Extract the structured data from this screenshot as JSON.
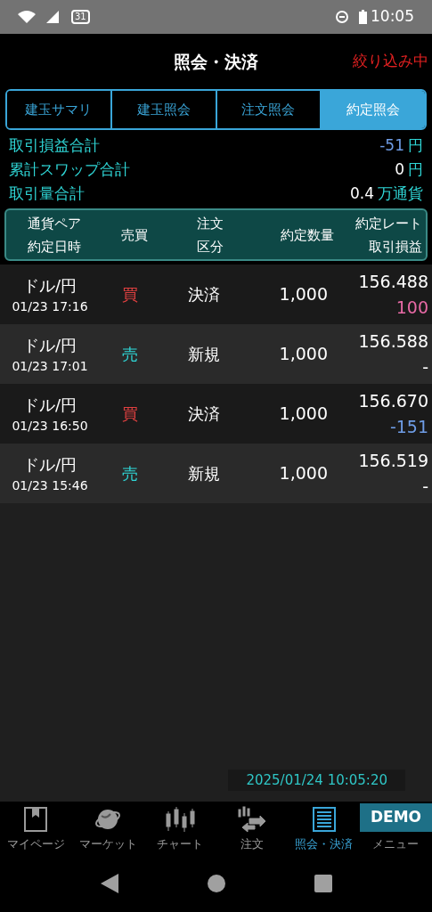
{
  "status_bar": {
    "calendar_day": "31",
    "time": "10:05"
  },
  "header": {
    "title": "照会・決済",
    "filter_status": "絞り込み中"
  },
  "tabs": [
    {
      "label": "建玉サマリ",
      "selected": false
    },
    {
      "label": "建玉照会",
      "selected": false
    },
    {
      "label": "注文照会",
      "selected": false
    },
    {
      "label": "約定照会",
      "selected": true
    }
  ],
  "summary": [
    {
      "label": "取引損益合計",
      "value": "-51",
      "unit": "円",
      "kind": "loss"
    },
    {
      "label": "累計スワップ合計",
      "value": "0",
      "unit": "円",
      "kind": "none"
    },
    {
      "label": "取引量合計",
      "value": "0.4",
      "unit": "万通貨",
      "kind": "none"
    }
  ],
  "table": {
    "columns": [
      {
        "top": "通貨ペア",
        "bottom": "約定日時"
      },
      {
        "top": "売買"
      },
      {
        "top": "注文",
        "bottom": "区分"
      },
      {
        "top": "約定数量"
      },
      {
        "top": "約定レート",
        "bottom": "取引損益"
      }
    ],
    "rows": [
      {
        "pair": "ドル/円",
        "datetime": "01/23 17:16",
        "side": {
          "text": "買",
          "color": "#e04040"
        },
        "order_type": "決済",
        "quantity": "1,000",
        "rate": "156.488",
        "pl": {
          "text": "100",
          "color": "#e86aa6"
        }
      },
      {
        "pair": "ドル/円",
        "datetime": "01/23 17:01",
        "side": {
          "text": "売",
          "color": "#2fd6d6"
        },
        "order_type": "新規",
        "quantity": "1,000",
        "rate": "156.588",
        "pl": {
          "text": "-",
          "color": "#ffffff"
        }
      },
      {
        "pair": "ドル/円",
        "datetime": "01/23 16:50",
        "side": {
          "text": "買",
          "color": "#e04040"
        },
        "order_type": "決済",
        "quantity": "1,000",
        "rate": "156.670",
        "pl": {
          "text": "-151",
          "color": "#6f9de6"
        }
      },
      {
        "pair": "ドル/円",
        "datetime": "01/23 15:46",
        "side": {
          "text": "売",
          "color": "#2fd6d6"
        },
        "order_type": "新規",
        "quantity": "1,000",
        "rate": "156.519",
        "pl": {
          "text": "-",
          "color": "#ffffff"
        }
      }
    ]
  },
  "timestamp": "2025/01/24 10:05:20",
  "bottom_nav": [
    {
      "label": "マイページ",
      "kind": "bookmark",
      "selected": false
    },
    {
      "label": "マーケット",
      "kind": "globe",
      "selected": false
    },
    {
      "label": "チャート",
      "kind": "candles",
      "selected": false
    },
    {
      "label": "注文",
      "kind": "order",
      "selected": false
    },
    {
      "label": "照会・決済",
      "kind": "list",
      "selected": true
    },
    {
      "label": "メニュー",
      "kind": "badge",
      "badge": "DEMO",
      "selected": false
    }
  ]
}
